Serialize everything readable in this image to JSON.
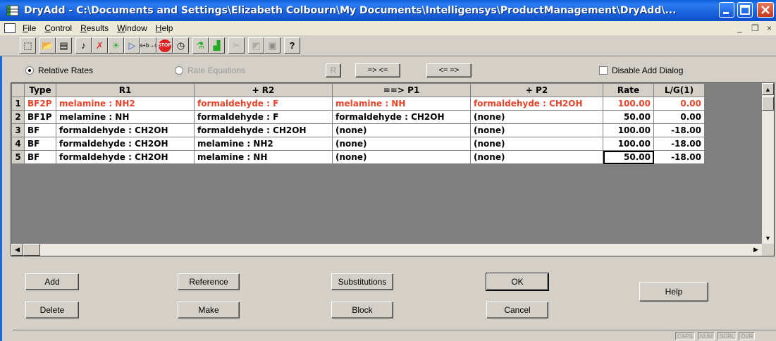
{
  "window": {
    "title": "DryAdd - C:\\Documents and Settings\\Elizabeth Colbourn\\My Documents\\Intelligensys\\ProductManagement\\DryAdd\\...",
    "app_icon": "grid-app-icon",
    "controls": [
      "minimize",
      "maximize",
      "close"
    ]
  },
  "menubar": {
    "items": [
      "File",
      "Control",
      "Results",
      "Window",
      "Help"
    ],
    "mdi_controls": [
      "_",
      "❐",
      "×"
    ]
  },
  "toolbar": {
    "buttons": [
      "new-icon",
      "open-icon",
      "save-icon",
      "note-icon",
      "check-icon",
      "sun-icon",
      "triangle-icon",
      "equation-icon",
      "stop-icon",
      "clock-icon",
      "flask-icon",
      "beaker-icon",
      "tools-icon",
      "chart-icon",
      "lab-icon",
      "help-icon"
    ],
    "labels": {
      "equation": "a+b→c",
      "stop": "STOP",
      "help": "?"
    }
  },
  "options": {
    "relative_rates": "Relative Rates",
    "rate_equations": "Rate Equations",
    "r_button": "R",
    "forward_button": "=> <=",
    "reverse_button": "<= =>",
    "disable_add_dialog": "Disable Add Dialog"
  },
  "table": {
    "columns": [
      "Type",
      "R1",
      "+ R2",
      "==> P1",
      "+ P2",
      "Rate",
      "L/G(1)"
    ],
    "rows": [
      {
        "n": "1",
        "type": "BF2P",
        "r1": "melamine : NH2",
        "r2": "formaldehyde : F",
        "p1": "melamine : NH",
        "p2": "formaldehyde : CH2OH",
        "rate": "100.00",
        "lg": "0.00",
        "highlight": true
      },
      {
        "n": "2",
        "type": "BF1P",
        "r1": "melamine : NH",
        "r2": "formaldehyde : F",
        "p1": "formaldehyde : CH2OH",
        "p2": "(none)",
        "rate": "50.00",
        "lg": "0.00"
      },
      {
        "n": "3",
        "type": "BF",
        "r1": "formaldehyde : CH2OH",
        "r2": "formaldehyde : CH2OH",
        "p1": "(none)",
        "p2": "(none)",
        "rate": "100.00",
        "lg": "-18.00"
      },
      {
        "n": "4",
        "type": "BF",
        "r1": "formaldehyde : CH2OH",
        "r2": "melamine : NH2",
        "p1": "(none)",
        "p2": "(none)",
        "rate": "100.00",
        "lg": "-18.00"
      },
      {
        "n": "5",
        "type": "BF",
        "r1": "formaldehyde : CH2OH",
        "r2": "melamine : NH",
        "p1": "(none)",
        "p2": "(none)",
        "rate": "50.00",
        "lg": "-18.00",
        "selected_rate": true
      }
    ],
    "highlight_color": "#e8442a"
  },
  "buttons": {
    "add": "Add",
    "delete": "Delete",
    "reference": "Reference",
    "make": "Make",
    "substitutions": "Substitutions",
    "block": "Block",
    "ok": "OK",
    "cancel": "Cancel",
    "help": "Help"
  },
  "statusbar": {
    "panels": [
      "CAPS",
      "NUM",
      "SCRL",
      "OVR"
    ]
  }
}
